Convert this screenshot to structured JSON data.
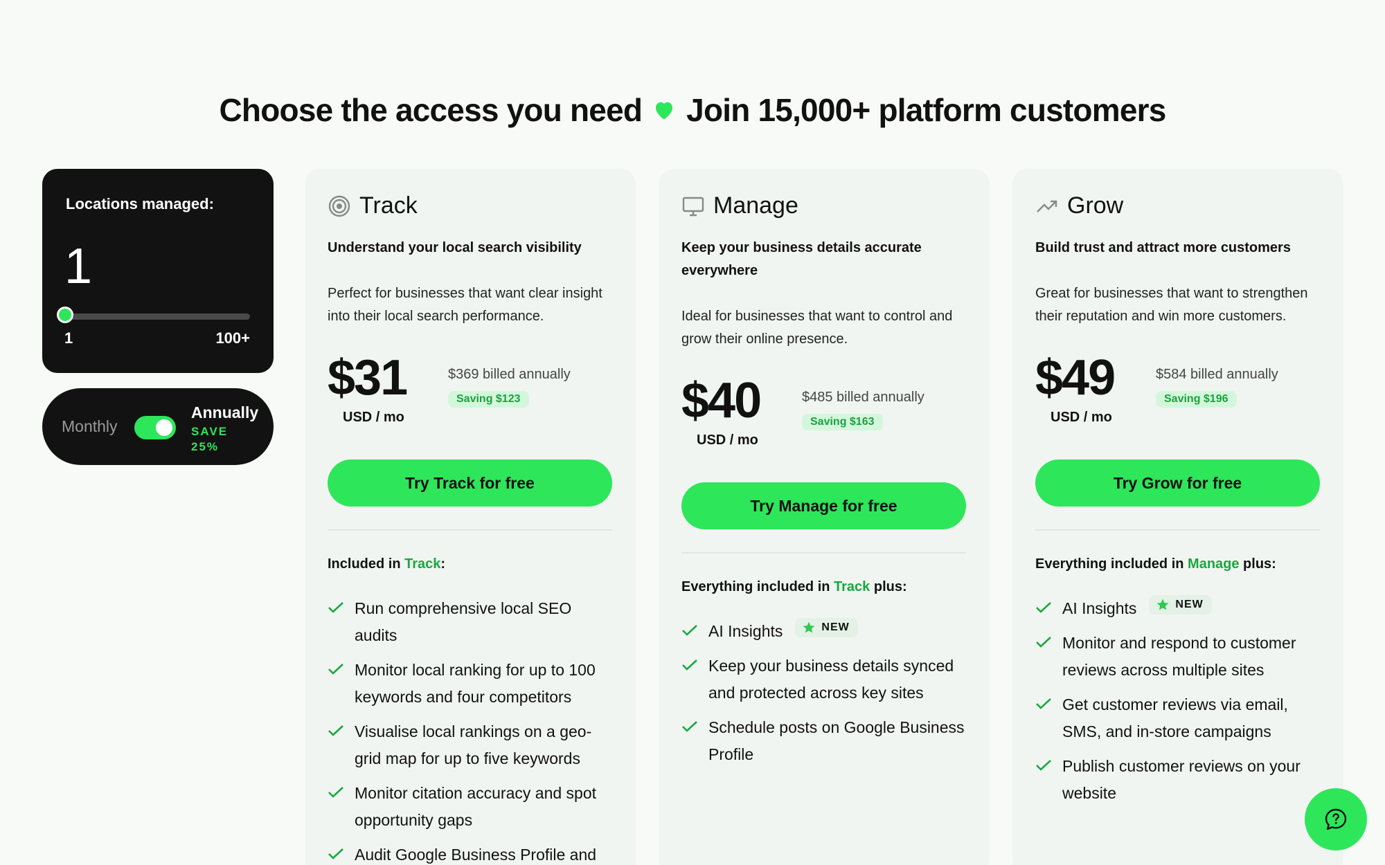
{
  "headline": {
    "left": "Choose the access you need",
    "right": "Join 15,000+ platform customers",
    "heart_icon": "heart-icon",
    "heart_color": "#2ee65a"
  },
  "locations": {
    "title": "Locations managed:",
    "value": "1",
    "min_label": "1",
    "max_label": "100+",
    "slider_level": 0
  },
  "billing": {
    "monthly_label": "Monthly",
    "annually_label": "Annually",
    "save_label": "SAVE 25%",
    "annual_selected": true
  },
  "plans": [
    {
      "name": "Track",
      "icon": "target-icon",
      "tagline": "Understand your local search visibility",
      "description": "Perfect for businesses that want clear insight into their local search performance.",
      "price": "$31",
      "unit": "USD / mo",
      "billed": "$369 billed annually",
      "saving": "Saving $123",
      "cta": "Try Track for free",
      "included_prefix": "Included in ",
      "included_highlight": "Track",
      "included_suffix": ":",
      "features": [
        "Run comprehensive local SEO audits",
        "Monitor local ranking for up to 100 keywords and four competitors",
        "Visualise local rankings on a geo-grid map for up to five keywords",
        "Monitor citation accuracy and spot opportunity gaps",
        "Audit Google Business Profile and"
      ]
    },
    {
      "name": "Manage",
      "icon": "monitor-icon",
      "tagline": "Keep your business details accurate everywhere",
      "description": "Ideal for businesses that want to control and grow their online presence.",
      "price": "$40",
      "unit": "USD / mo",
      "billed": "$485 billed annually",
      "saving": "Saving $163",
      "cta": "Try Manage for free",
      "included_prefix": "Everything included in ",
      "included_highlight": "Track",
      "included_suffix": " plus:",
      "new_label": "NEW",
      "features": [
        "AI Insights",
        "Keep your business details synced and protected across key sites",
        "Schedule posts on Google Business Profile"
      ]
    },
    {
      "name": "Grow",
      "icon": "trending-up-icon",
      "tagline": "Build trust and attract more customers",
      "description": "Great for businesses that want to strengthen their reputation and win more customers.",
      "price": "$49",
      "unit": "USD / mo",
      "billed": "$584 billed annually",
      "saving": "Saving $196",
      "cta": "Try Grow for free",
      "included_prefix": "Everything included in ",
      "included_highlight": "Manage",
      "included_suffix": " plus:",
      "new_label": "NEW",
      "features": [
        "AI Insights",
        "Monitor and respond to customer reviews across multiple sites",
        "Get customer reviews via email, SMS, and in-store campaigns",
        "Publish customer reviews on your website"
      ]
    }
  ],
  "help": {
    "icon": "help-chat-icon"
  },
  "colors": {
    "accent": "#2ee65a",
    "accent_text": "#18a83e",
    "dark": "#121212",
    "card": "#f1f5f2"
  }
}
